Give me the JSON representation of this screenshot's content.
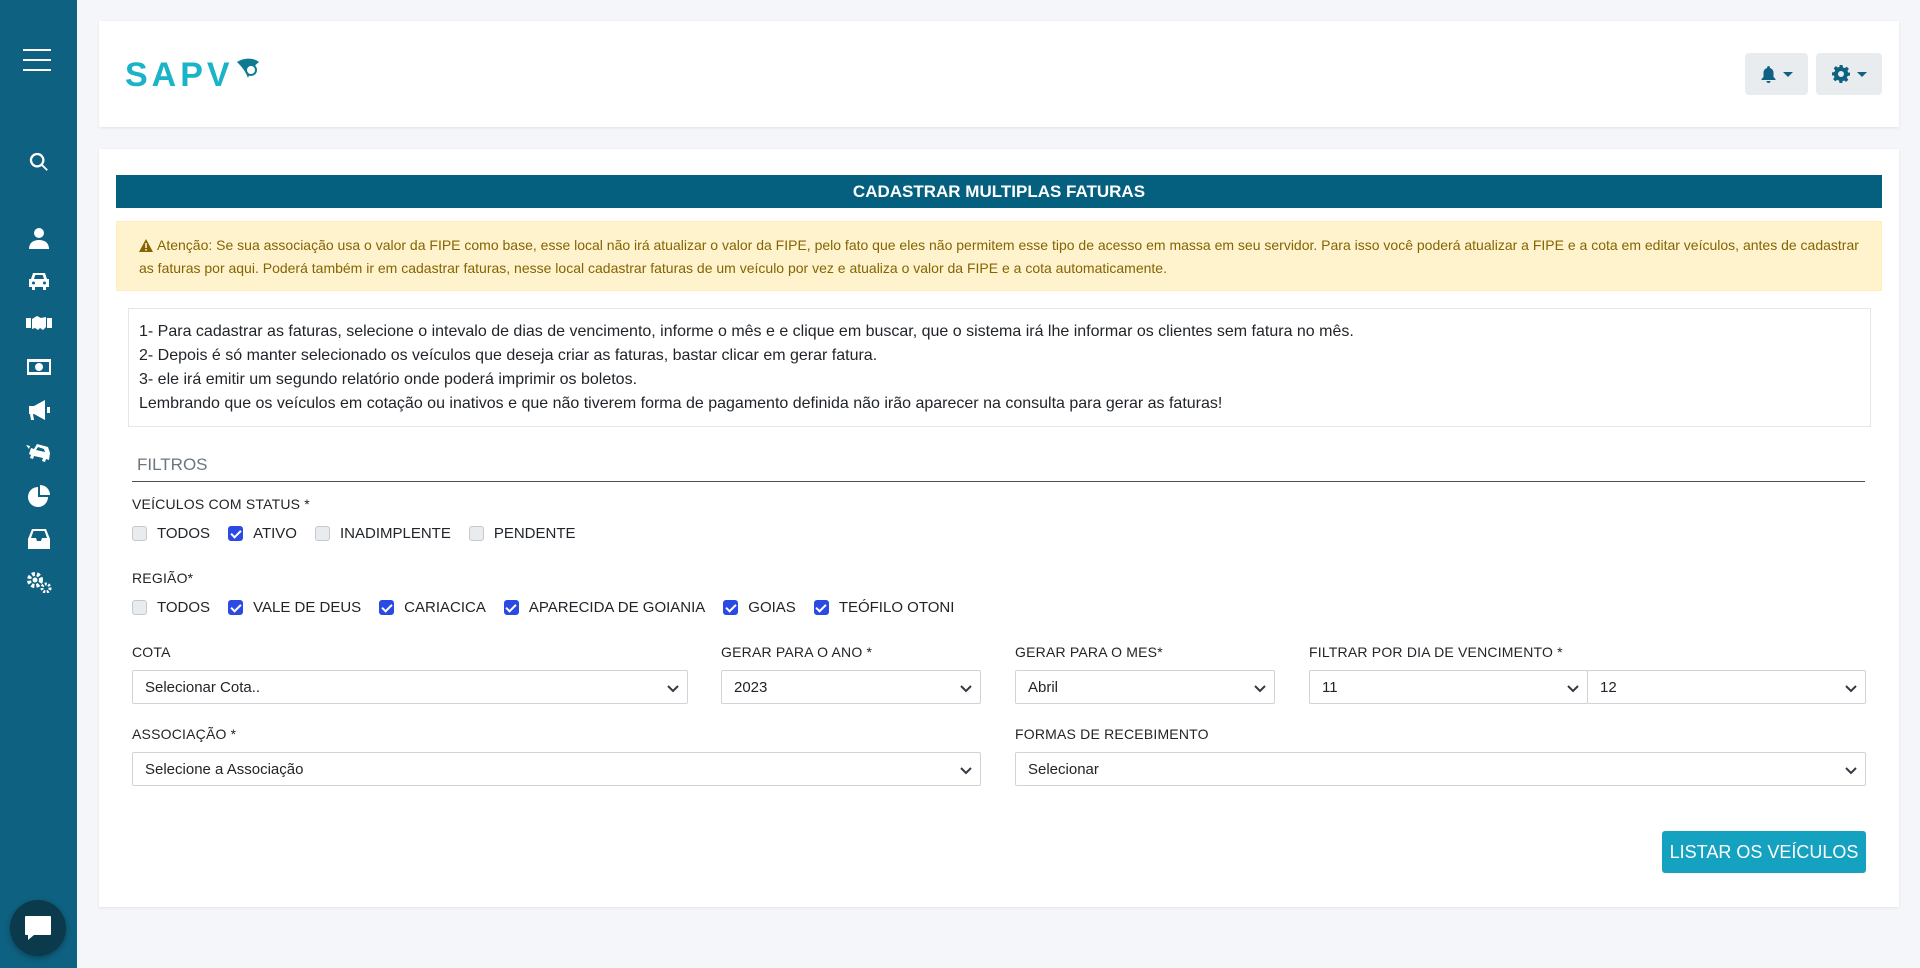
{
  "app": {
    "logo_text": "SAPV"
  },
  "sidebar": {
    "items": [
      {
        "icon": "menu-icon"
      },
      {
        "icon": "search-icon"
      },
      {
        "icon": "user-icon"
      },
      {
        "icon": "car-icon"
      },
      {
        "icon": "handshake-icon"
      },
      {
        "icon": "money-icon"
      },
      {
        "icon": "megaphone-icon"
      },
      {
        "icon": "car-crash-icon"
      },
      {
        "icon": "pie-chart-icon"
      },
      {
        "icon": "inbox-icon"
      },
      {
        "icon": "cogs-icon"
      }
    ],
    "chat_icon": "chat-icon"
  },
  "header": {
    "notifications_icon": "bell-icon",
    "settings_icon": "gear-icon"
  },
  "page": {
    "title": "CADASTRAR MULTIPLAS FATURAS",
    "warning": {
      "icon": "warning-icon",
      "text": "Atenção: Se sua associação usa o valor da FIPE como base, esse local não irá atualizar o valor da FIPE, pelo fato que eles não permitem esse tipo de acesso em massa em seu servidor. Para isso você poderá atualizar a FIPE e a cota em editar veículos, antes de cadastrar as faturas por aqui. Poderá também ir em cadastrar faturas, nesse local cadastrar faturas de um veículo por vez e atualiza o valor da FIPE e a cota automaticamente."
    },
    "instructions": [
      "1- Para cadastrar as faturas, selecione o intevalo de dias de vencimento, informe o mês e e clique em buscar, que o sistema irá lhe informar os clientes sem fatura no mês.",
      "2- Depois é só manter selecionado os veículos que deseja criar as faturas, bastar clicar em gerar fatura.",
      "3- ele irá emitir um segundo relatório onde poderá imprimir os boletos.",
      "Lembrando que os veículos em cotação ou inativos e que não tiverem forma de pagamento definida não irão aparecer na consulta para gerar as faturas!"
    ],
    "filters_title": "FILTROS",
    "status": {
      "label": "VEÍCULOS COM STATUS *",
      "options": [
        {
          "label": "TODOS",
          "checked": false
        },
        {
          "label": "ATIVO",
          "checked": true
        },
        {
          "label": "INADIMPLENTE",
          "checked": false
        },
        {
          "label": "PENDENTE",
          "checked": false
        }
      ]
    },
    "region": {
      "label": "REGIÃO*",
      "options": [
        {
          "label": "TODOS",
          "checked": false
        },
        {
          "label": "VALE DE DEUS",
          "checked": true
        },
        {
          "label": "CARIACICA",
          "checked": true
        },
        {
          "label": "APARECIDA DE GOIANIA",
          "checked": true
        },
        {
          "label": "GOIAS",
          "checked": true
        },
        {
          "label": "TEÓFILO OTONI",
          "checked": true
        }
      ]
    },
    "cota": {
      "label": "COTA",
      "value": "Selecionar Cota.."
    },
    "year": {
      "label": "GERAR PARA O ANO *",
      "value": "2023"
    },
    "month": {
      "label": "GERAR PARA O MES*",
      "value": "Abril"
    },
    "due_day": {
      "label": "FILTRAR POR DIA DE VENCIMENTO *",
      "from": "11",
      "to": "12"
    },
    "association": {
      "label": "ASSOCIAÇÃO *",
      "value": "Selecione a Associação"
    },
    "payment": {
      "label": "FORMAS DE RECEBIMENTO",
      "value": "Selecionar"
    },
    "submit_label": "LISTAR OS VEÍCULOS"
  }
}
